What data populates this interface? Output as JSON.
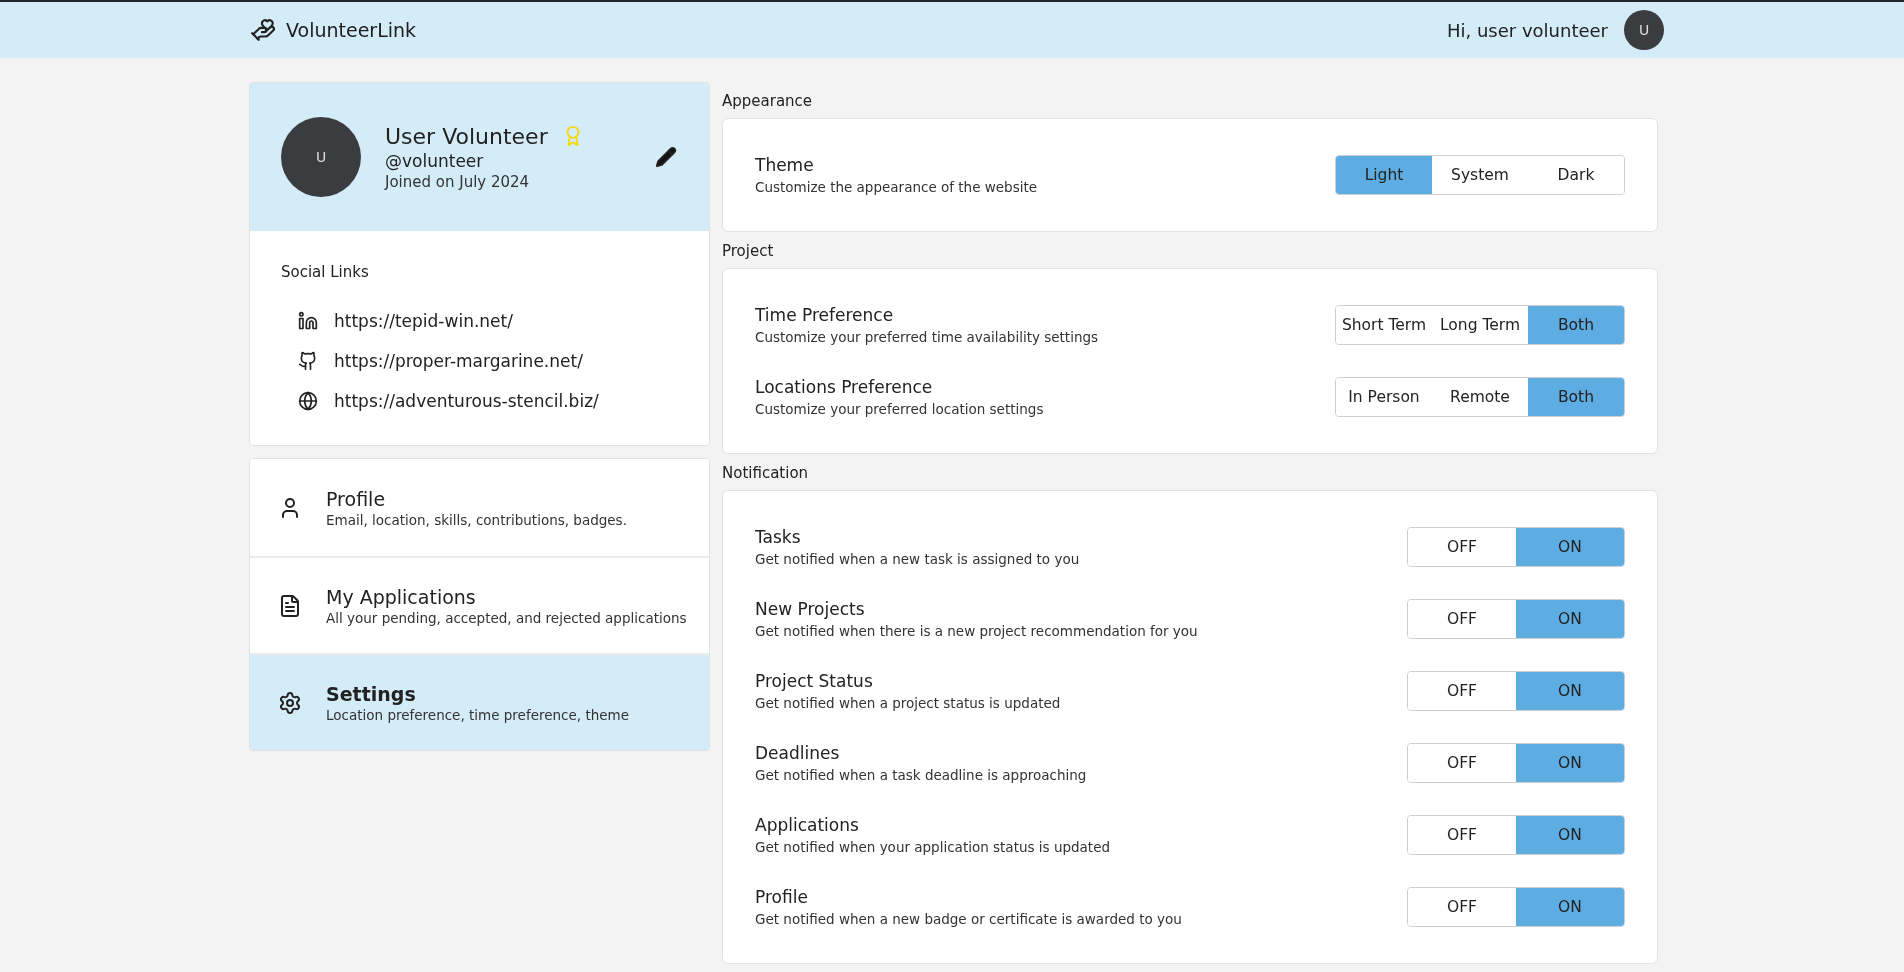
{
  "header": {
    "brand": "VolunteerLink",
    "greeting": "Hi, user volunteer",
    "avatar_initial": "U"
  },
  "profile": {
    "avatar_initial": "U",
    "name": "User Volunteer",
    "handle": "@volunteer",
    "joined": "Joined on July 2024"
  },
  "social_links": {
    "title": "Social Links",
    "links": [
      {
        "kind": "linkedin",
        "url": "https://tepid-win.net/"
      },
      {
        "kind": "github",
        "url": "https://proper-margarine.net/"
      },
      {
        "kind": "web",
        "url": "https://adventurous-stencil.biz/"
      }
    ]
  },
  "menu": [
    {
      "kind": "profile",
      "title": "Profile",
      "subtitle": "Email, location, skills, contributions, badges.",
      "selected": false
    },
    {
      "kind": "applications",
      "title": "My Applications",
      "subtitle": "All your pending, accepted, and rejected applications",
      "selected": false
    },
    {
      "kind": "settings",
      "title": "Settings",
      "subtitle": "Location preference, time preference, theme",
      "selected": true
    }
  ],
  "sections": [
    {
      "title": "Appearance",
      "rows": [
        {
          "kind": "segmented",
          "title": "Theme",
          "description": "Customize the appearance of the website",
          "options": [
            {
              "label": "Light",
              "selected": true
            },
            {
              "label": "System",
              "selected": false
            },
            {
              "label": "Dark",
              "selected": false
            }
          ]
        }
      ]
    },
    {
      "title": "Project",
      "rows": [
        {
          "kind": "segmented",
          "title": "Time Preference",
          "description": "Customize your preferred time availability settings",
          "options": [
            {
              "label": "Short Term",
              "selected": false
            },
            {
              "label": "Long Term",
              "selected": false
            },
            {
              "label": "Both",
              "selected": true
            }
          ]
        },
        {
          "kind": "segmented",
          "title": "Locations Preference",
          "description": "Customize your preferred location settings",
          "options": [
            {
              "label": "In Person",
              "selected": false
            },
            {
              "label": "Remote",
              "selected": false
            },
            {
              "label": "Both",
              "selected": true
            }
          ]
        }
      ]
    },
    {
      "title": "Notification",
      "rows": [
        {
          "kind": "toggle",
          "title": "Tasks",
          "description": "Get notified when a new task is assigned to you",
          "options": [
            {
              "label": "OFF",
              "selected": false
            },
            {
              "label": "ON",
              "selected": true
            }
          ]
        },
        {
          "kind": "toggle",
          "title": "New Projects",
          "description": "Get notified when there is a new project recommendation for you",
          "options": [
            {
              "label": "OFF",
              "selected": false
            },
            {
              "label": "ON",
              "selected": true
            }
          ]
        },
        {
          "kind": "toggle",
          "title": "Project Status",
          "description": "Get notified when a project status is updated",
          "options": [
            {
              "label": "OFF",
              "selected": false
            },
            {
              "label": "ON",
              "selected": true
            }
          ]
        },
        {
          "kind": "toggle",
          "title": "Deadlines",
          "description": "Get notified when a task deadline is approaching",
          "options": [
            {
              "label": "OFF",
              "selected": false
            },
            {
              "label": "ON",
              "selected": true
            }
          ]
        },
        {
          "kind": "toggle",
          "title": "Applications",
          "description": "Get notified when your application status is updated",
          "options": [
            {
              "label": "OFF",
              "selected": false
            },
            {
              "label": "ON",
              "selected": true
            }
          ]
        },
        {
          "kind": "toggle",
          "title": "Profile",
          "description": "Get notified when a new badge or certificate is awarded to you",
          "options": [
            {
              "label": "OFF",
              "selected": false
            },
            {
              "label": "ON",
              "selected": true
            }
          ]
        }
      ]
    }
  ]
}
